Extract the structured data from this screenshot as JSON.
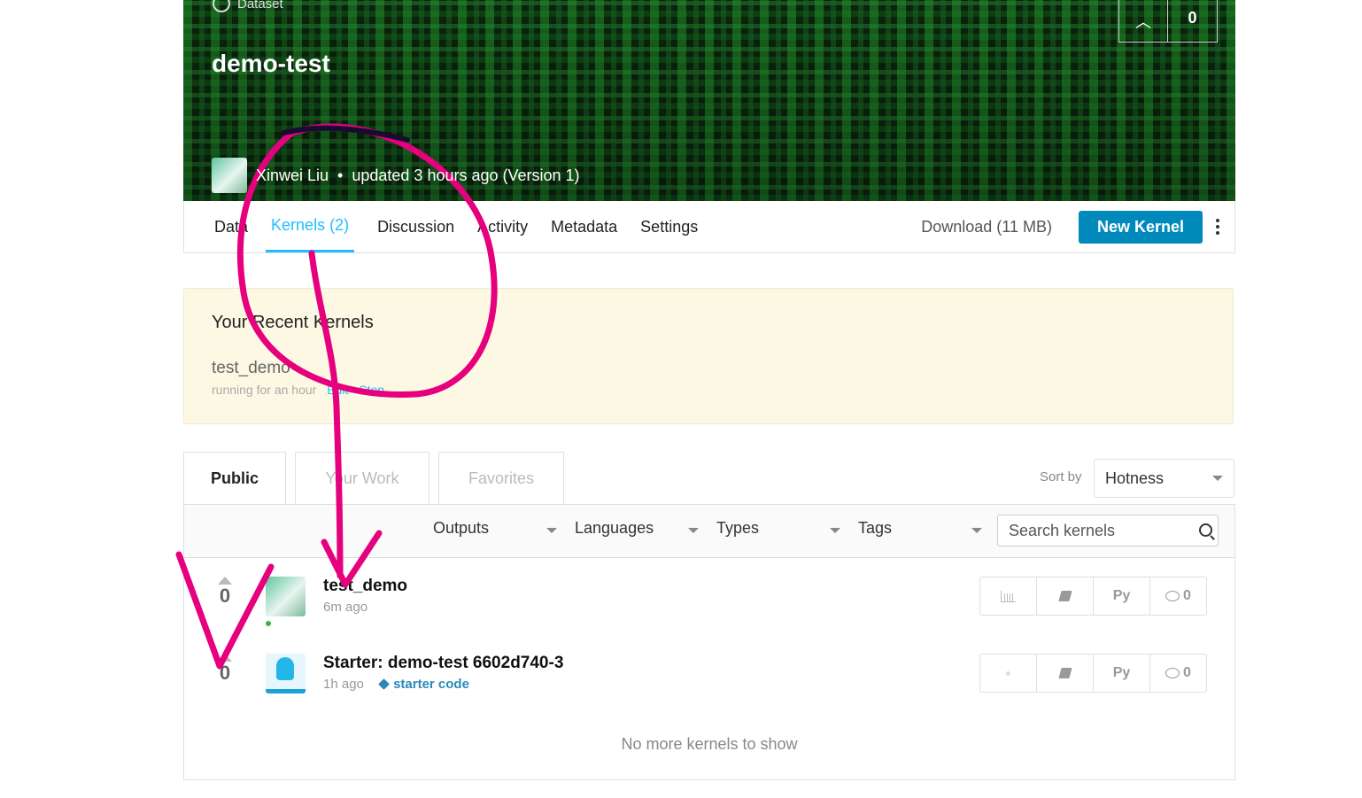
{
  "header": {
    "type_label": "Dataset",
    "title": "demo-test",
    "vote_count": "0",
    "owner_name": "Xinwei Liu",
    "updated_text": "updated 3 hours ago (Version 1)"
  },
  "nav": {
    "tabs": [
      {
        "label": "Data"
      },
      {
        "label": "Kernels (2)"
      },
      {
        "label": "Discussion"
      },
      {
        "label": "Activity"
      },
      {
        "label": "Metadata"
      },
      {
        "label": "Settings"
      }
    ],
    "download_label": "Download (11 MB)",
    "new_kernel_label": "New Kernel"
  },
  "recent": {
    "heading": "Your Recent Kernels",
    "kernel_name": "test_demo",
    "status": "running for an hour",
    "edit_label": "Edit",
    "stop_label": "Stop"
  },
  "kernel_tabs": [
    {
      "label": "Public"
    },
    {
      "label": "Your Work"
    },
    {
      "label": "Favorites"
    }
  ],
  "sort": {
    "label": "Sort by",
    "value": "Hotness"
  },
  "filters": [
    {
      "label": "Outputs"
    },
    {
      "label": "Languages"
    },
    {
      "label": "Types"
    },
    {
      "label": "Tags"
    }
  ],
  "search": {
    "placeholder": "Search kernels"
  },
  "kernels": [
    {
      "votes": "0",
      "title": "test_demo",
      "time": "6m ago",
      "tag": "",
      "language": "Py",
      "comments": "0"
    },
    {
      "votes": "0",
      "title": "Starter: demo-test 6602d740-3",
      "time": "1h ago",
      "tag": "starter code",
      "language": "Py",
      "comments": "0"
    }
  ],
  "footer_text": "No more kernels to show",
  "colors": {
    "accent": "#20beff",
    "button": "#008abc",
    "annotation": "#e6007e"
  }
}
